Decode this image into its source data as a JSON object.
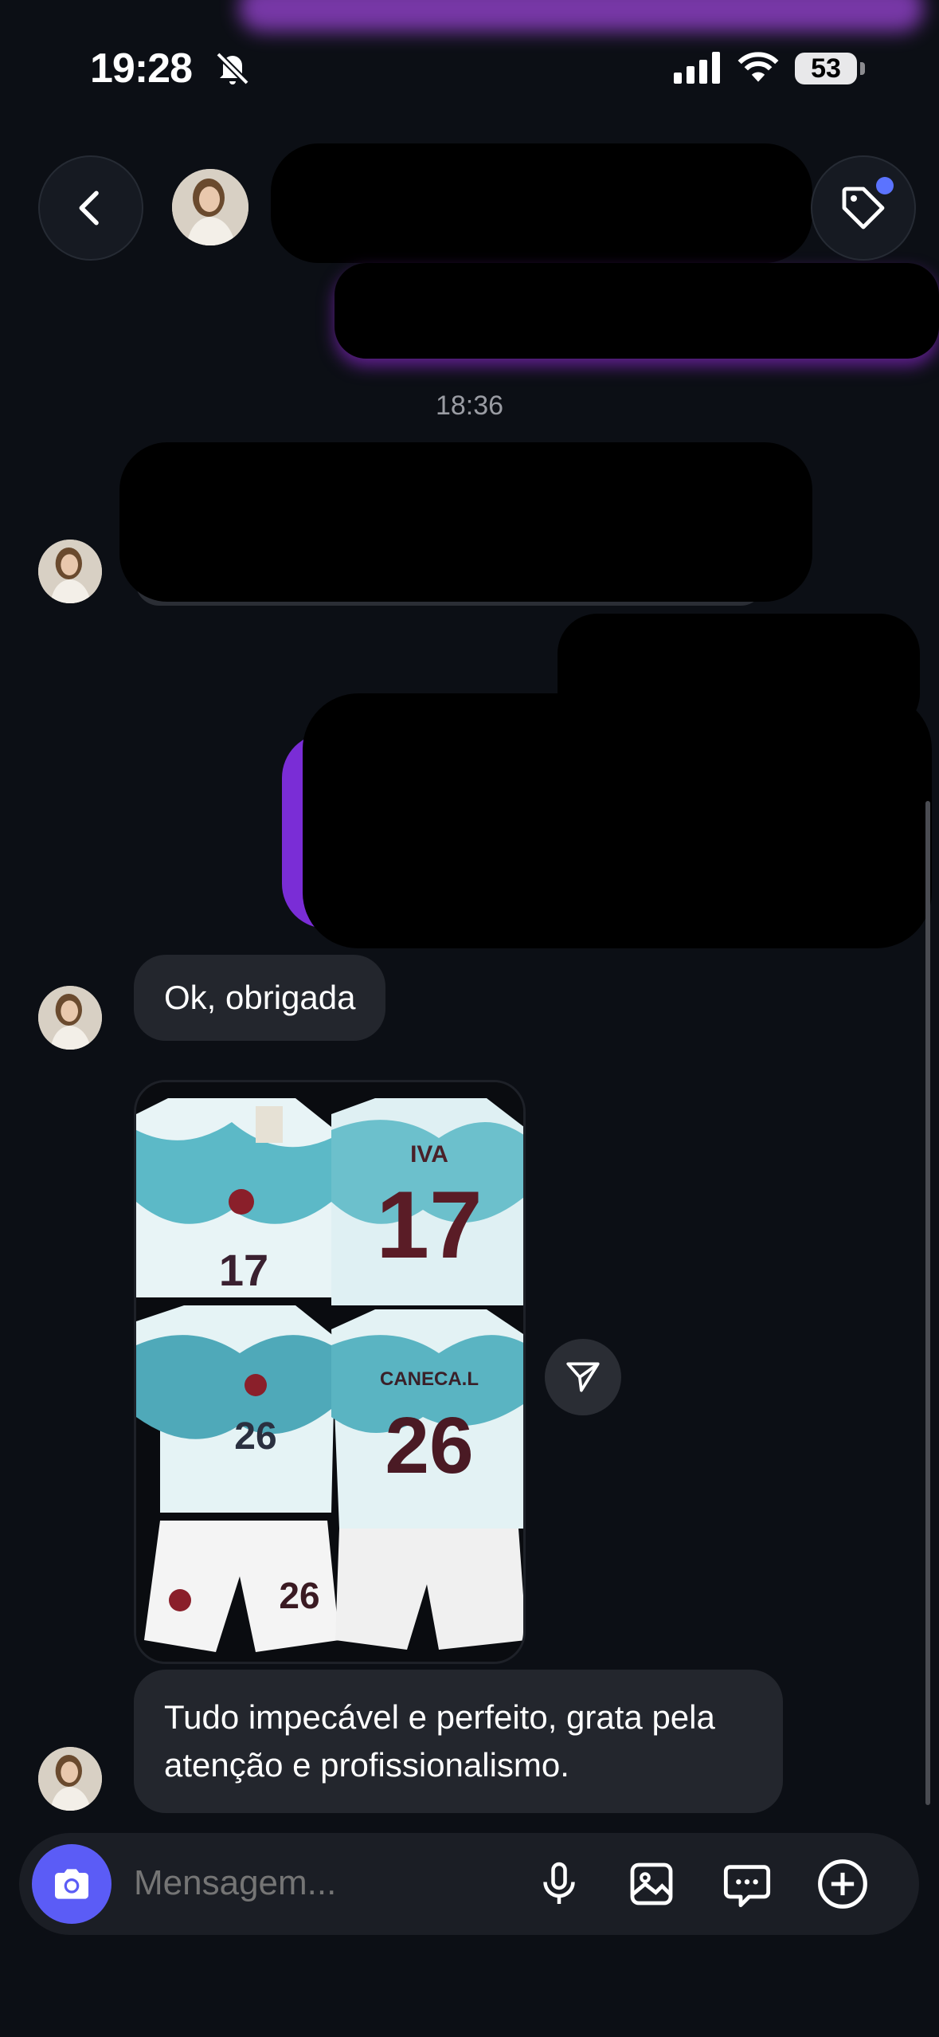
{
  "status_bar": {
    "time": "19:28",
    "battery": "53"
  },
  "conversation": {
    "timestamp": "18:36",
    "message_1": "Ok, obrigada",
    "message_2": "Tudo impecável e perfeito, grata pela atenção e profissionalismo."
  },
  "photo": {
    "jersey_name_1": "IVA",
    "jersey_number_1": "17",
    "jersey_number_2": "17",
    "jersey_name_2": "CANECA.L",
    "jersey_number_3": "26",
    "jersey_number_4": "26",
    "shorts_number": "26"
  },
  "composer": {
    "placeholder": "Mensagem..."
  },
  "colors": {
    "background": "#0c0f15",
    "bubble_incoming": "#23262d",
    "bubble_outgoing": "#7a2dd6",
    "accent": "#5b5cf6"
  },
  "icons": {
    "back": "chevron-left-icon",
    "tag": "tag-icon",
    "share": "send-icon",
    "camera": "camera-icon",
    "mic": "microphone-icon",
    "gallery": "image-icon",
    "sticker": "chat-bubble-icon",
    "plus": "plus-circle-icon"
  }
}
